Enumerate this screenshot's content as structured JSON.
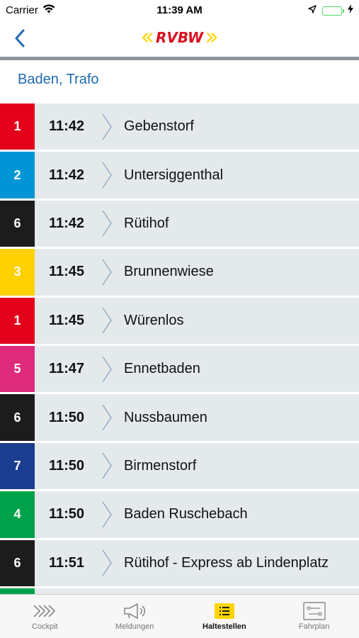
{
  "status_bar": {
    "carrier": "Carrier",
    "time": "11:39 AM"
  },
  "nav": {
    "logo_text": "RVBW"
  },
  "stop": {
    "name": "Baden, Trafo"
  },
  "departures": [
    {
      "line": "1",
      "time": "11:42",
      "destination": "Gebenstorf",
      "color": "#e3001b"
    },
    {
      "line": "2",
      "time": "11:42",
      "destination": "Untersiggenthal",
      "color": "#0096d6"
    },
    {
      "line": "6",
      "time": "11:42",
      "destination": "Rütihof",
      "color": "#1c1c1c"
    },
    {
      "line": "3",
      "time": "11:45",
      "destination": "Brunnenwiese",
      "color": "#fed100"
    },
    {
      "line": "1",
      "time": "11:45",
      "destination": "Würenlos",
      "color": "#e3001b"
    },
    {
      "line": "5",
      "time": "11:47",
      "destination": "Ennetbaden",
      "color": "#dd2a7b"
    },
    {
      "line": "6",
      "time": "11:50",
      "destination": "Nussbaumen",
      "color": "#1c1c1c"
    },
    {
      "line": "7",
      "time": "11:50",
      "destination": "Birmenstorf",
      "color": "#1b3d8f"
    },
    {
      "line": "4",
      "time": "11:50",
      "destination": "Baden Ruschebach",
      "color": "#00a14b"
    },
    {
      "line": "6",
      "time": "11:51",
      "destination": "Rütihof - Express ab Lindenplatz",
      "color": "#1c1c1c"
    },
    {
      "line": "",
      "time": "",
      "destination": "",
      "color": "#00a14b"
    }
  ],
  "tabs": [
    {
      "label": "Cockpit",
      "icon": "chevrons-icon"
    },
    {
      "label": "Meldungen",
      "icon": "megaphone-icon"
    },
    {
      "label": "Haltestellen",
      "icon": "list-icon",
      "active": true
    },
    {
      "label": "Fahrplan",
      "icon": "route-icon"
    }
  ],
  "colors": {
    "accent": "#1f6ab2",
    "logo_red": "#d9101f",
    "logo_yellow": "#ffd400",
    "row_bg": "#e4e9eb",
    "active_tab": "#ffd400"
  }
}
